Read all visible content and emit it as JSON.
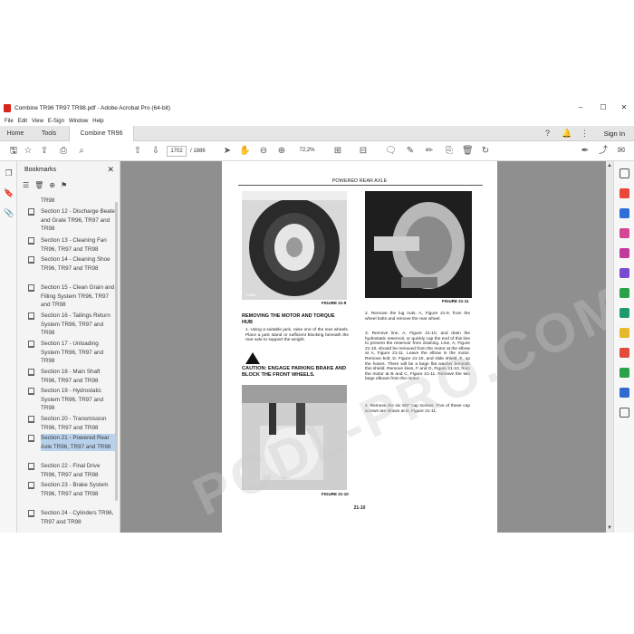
{
  "window": {
    "title": "Combine TR96 TR97 TR98.pdf - Adobe Acrobat Pro (64-bit)",
    "controls": [
      "–",
      "☐",
      "✕"
    ]
  },
  "menu": [
    "File",
    "Edit",
    "View",
    "E-Sign",
    "Window",
    "Help"
  ],
  "tabs": {
    "home": "Home",
    "tools": "Tools",
    "document": "Combine TR96 TR9...",
    "close": "×",
    "signin": "Sign In"
  },
  "toolbar": {
    "page_current": "1702",
    "page_total": "/ 1886",
    "zoom": "72,2%"
  },
  "bookmarks": {
    "title": "Bookmarks",
    "close": "✕",
    "items": [
      {
        "label": "TR98"
      },
      {
        "label": "Section 12 - Discharge Beater and Grate TR96, TR97 and TR98"
      },
      {
        "label": "Section 13 - Cleaning Fan TR96, TR97 and TR98"
      },
      {
        "label": "Section 14 - Cleaning Shoe TR96, TR97 and TR98"
      },
      {
        "label": "Section 15 - Clean Grain and Filling System TR96, TR97 and TR98"
      },
      {
        "label": "Section 16 - Tailings Return System TR96, TR97 and TR98"
      },
      {
        "label": "Section 17 - Unloading System TR96, TR97 and TR98"
      },
      {
        "label": "Section 18 - Main Shaft TR96, TR97 and TR98"
      },
      {
        "label": "Section 19 - Hydrostatic System TR96, TR97 and TR98"
      },
      {
        "label": "Section 20 - Transmission TR96, TR97 and TR98"
      },
      {
        "label": "Section 21 - Powered Rear Axle TR96, TR97 and TR98",
        "selected": true
      },
      {
        "label": "Section 22 - Final Drive TR96, TR97 and TR98"
      },
      {
        "label": "Section 23 - Brake System TR96, TR97 and TR98"
      },
      {
        "label": "Section 24 - Cylinders TR96, TR97 and TR98"
      }
    ]
  },
  "document": {
    "header": "POWERED REAR AXLE",
    "fig_9": "FIGURE 21-9",
    "fig_11": "FIGURE 21-11",
    "fig_10": "FIGURE 21-10",
    "photo_label_9": "79660",
    "section_heading": "REMOVING THE MOTOR AND TORQUE HUB",
    "step1": "1. Using a suitable jack, raise one of the rear wheels. Place a jack stand or sufficient blocking beneath the rear axle to support the weight.",
    "caution": "CAUTION: ENGAGE PARKING BRAKE AND BLOCK THE FRONT WHEELS.",
    "step2": "2. Remove the lug nuts, A, Figure 21-9, from the wheel bolts and remove the rear wheel.",
    "step3": "3. Remove line, A, Figure 21-10, and drain the hydrostatic reservoir, or quickly cap the end of this line to prevent the reservoir from draining. Line, A, Figure 21-10, should be removed from the motor at the elbow at A, Figure 21-11. Leave the elbow in the motor. Remove bolt, D, Figure 21-10, and slide shield, E, up the hoses. There will be a large flat washer beneath this shield. Remove lines, F and G, Figure 21-10, from the motor at B and C, Figure 21-11. Remove the two large elbows from the motor.",
    "step4": "4. Remove the six 5/8\" cap screws. Five of these cap screws are shown at D, Figure 21-11.",
    "page_number": "21-10",
    "watermark": "PCDL-PRO.COM"
  }
}
